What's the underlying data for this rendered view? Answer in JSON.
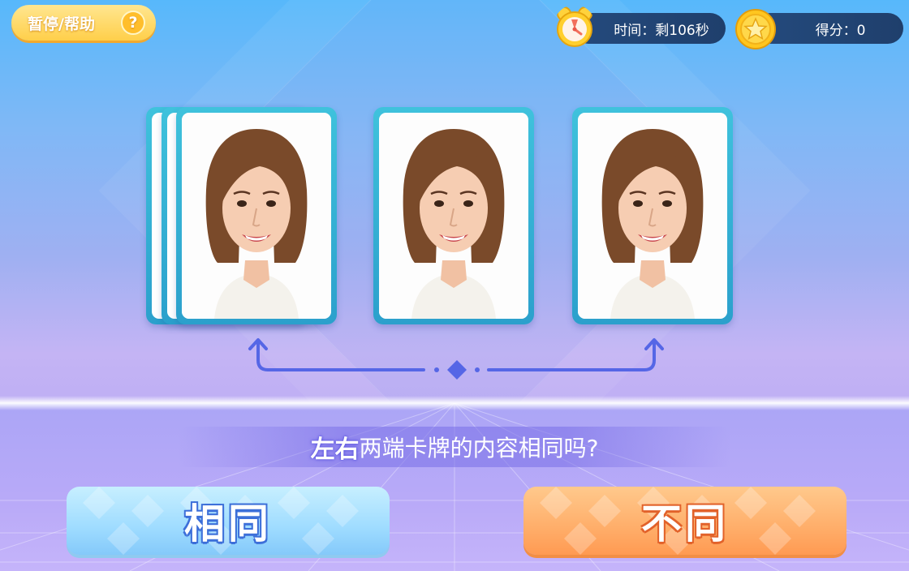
{
  "hud": {
    "pause_label": "暂停/帮助",
    "help_glyph": "?",
    "timer_text": "时间：剩106秒",
    "score_text": "得分：0"
  },
  "question": {
    "highlight": "左右",
    "text": "两端卡牌的内容相同吗?"
  },
  "answers": {
    "same_label": "相同",
    "different_label": "不同"
  },
  "cards": [
    {
      "id": "left-card-stack",
      "content": "portrait-woman"
    },
    {
      "id": "middle-card",
      "content": "portrait-woman"
    },
    {
      "id": "right-card",
      "content": "portrait-woman"
    }
  ],
  "colors": {
    "accent_blue": "#3c6fd9",
    "accent_orange": "#e2622a",
    "card_border": "#3fc2dc",
    "arrow": "#5566e6",
    "hud_dark": "#1f3f6c",
    "pause_yellow": "#ffcf4a"
  },
  "icons": [
    "alarm-clock-icon",
    "coin-star-icon",
    "help-icon",
    "double-arrow-icon"
  ]
}
